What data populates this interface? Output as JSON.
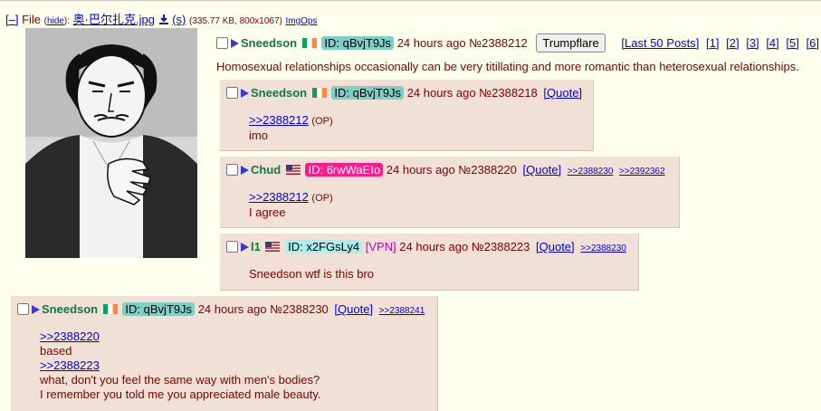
{
  "file": {
    "toggle": "[–]",
    "label": "File",
    "hide_label": "hide",
    "filename": "奥·巴尔扎克.jpg",
    "s_label": "(s)",
    "meta": "(335.77 KB, 800x1067)",
    "imgops": "ImgOps"
  },
  "op": {
    "name": "Sneedson",
    "flag": "ireland",
    "id": "ID: qBvjT9Js",
    "id_color": "#80cfc7",
    "time": "24 hours ago",
    "no": "№2388212",
    "button": "Trumpflare",
    "last50": "[Last 50 Posts]",
    "pages": [
      "[1]",
      "[2]",
      "[3]",
      "[4]",
      "[5]",
      "[6]"
    ],
    "message": "Homosexual relationships occasionally can be very titillating and more romantic than heterosexual relationships."
  },
  "replies": [
    {
      "name": "Sneedson",
      "flag": "ireland",
      "id": "ID: qBvjT9Js",
      "id_color": "#80cfc7",
      "time": "24 hours ago",
      "no": "№2388218",
      "quote": "[Quote]",
      "quote_ref": ">>2388212",
      "op_tag": "(OP)",
      "text": "imo"
    },
    {
      "name": "Chud",
      "flag": "usa",
      "id": "ID: 6rwWaEIo",
      "id_color": "#ff1a8c",
      "time": "24 hours ago",
      "no": "№2388220",
      "quote": "[Quote]",
      "backlinks": [
        ">>2388230",
        ">>2392362"
      ],
      "quote_ref": ">>2388212",
      "op_tag": "(OP)",
      "text": "I agree"
    },
    {
      "name": "l1",
      "flag": "usa",
      "id": "ID: x2FGsLy4",
      "id_color": "#a8f0f0",
      "vpn": "[VPN]",
      "time": "24 hours ago",
      "no": "№2388223",
      "quote": "[Quote]",
      "backlinks": [
        ">>2388230"
      ],
      "text": "Sneedson wtf is this bro"
    },
    {
      "name": "Sneedson",
      "flag": "ireland",
      "id": "ID: qBvjT9Js",
      "id_color": "#80cfc7",
      "time": "24 hours ago",
      "no": "№2388230",
      "quote": "[Quote]",
      "backlinks": [
        ">>2388241"
      ],
      "quote_ref_1": ">>2388220",
      "text_1": "based",
      "quote_ref_2": ">>2388223",
      "text_2": "what, don't you feel the same way with men's bodies?",
      "text_3": "I remember you told me you appreciated male beauty."
    }
  ]
}
